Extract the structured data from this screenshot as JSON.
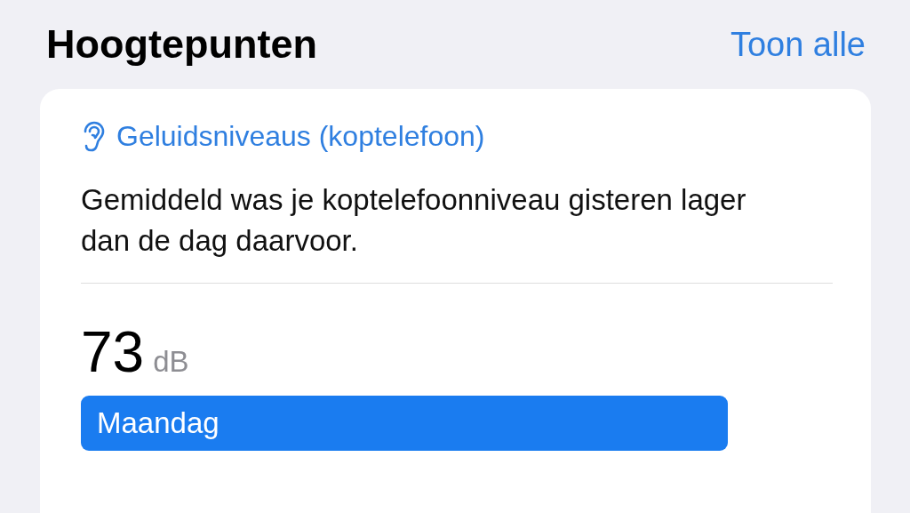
{
  "header": {
    "title": "Hoogtepunten",
    "link": "Toon alle"
  },
  "card": {
    "category": "Geluidsniveaus (koptelefoon)",
    "summary": "Gemiddeld was je koptelefoonniveau gisteren lager dan de dag daarvoor.",
    "value": "73",
    "unit": "dB",
    "bar": {
      "label": "Maandag"
    }
  }
}
